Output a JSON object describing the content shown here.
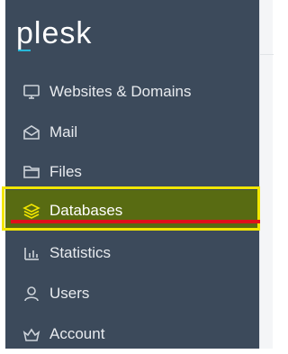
{
  "app": {
    "logo_text": "plesk",
    "accent_color": "#27b8d9"
  },
  "sidebar": {
    "background": "#3c4a5b",
    "items": [
      {
        "label": "Websites & Domains",
        "icon": "monitor-icon",
        "active": false
      },
      {
        "label": "Mail",
        "icon": "mail-icon",
        "active": false
      },
      {
        "label": "Files",
        "icon": "folder-icon",
        "active": false
      },
      {
        "label": "Databases",
        "icon": "database-stack-icon",
        "active": true
      },
      {
        "label": "Statistics",
        "icon": "bar-chart-icon",
        "active": false
      },
      {
        "label": "Users",
        "icon": "user-icon",
        "active": false
      },
      {
        "label": "Account",
        "icon": "crown-icon",
        "active": false
      }
    ]
  },
  "annotation": {
    "highlight_color": "#f2e600",
    "underline_color": "#e0101a"
  }
}
